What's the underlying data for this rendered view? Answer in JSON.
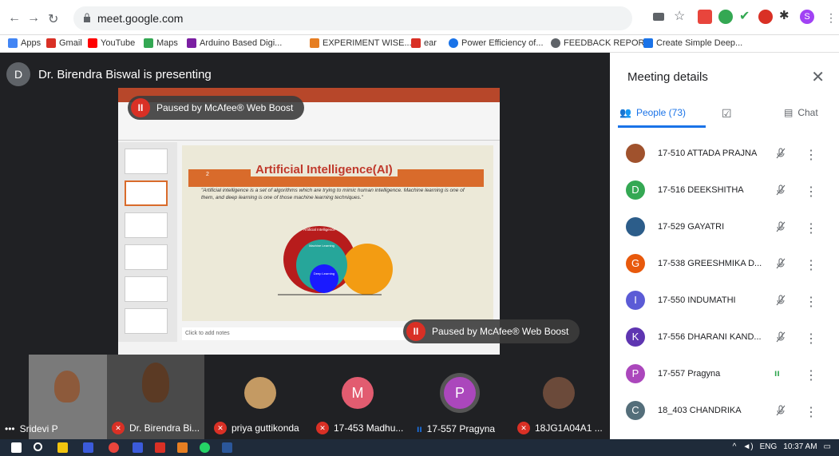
{
  "browser": {
    "url": "meet.google.com"
  },
  "bookmarks": [
    {
      "label": "Apps",
      "color": "#4285f4"
    },
    {
      "label": "Gmail",
      "color": "#d93025"
    },
    {
      "label": "YouTube",
      "color": "#ff0000"
    },
    {
      "label": "Maps",
      "color": "#34a853"
    },
    {
      "label": "Arduino Based Digi...",
      "color": "#7b1fa2"
    },
    {
      "label": "EXPERIMENT WISE...",
      "color": "#e67e22"
    },
    {
      "label": "ear",
      "color": "#d93025"
    },
    {
      "label": "Power Efficiency of...",
      "color": "#1a73e8"
    },
    {
      "label": "FEEDBACK REPORT",
      "color": "#5f6368"
    },
    {
      "label": "Create Simple Deep...",
      "color": "#1a73e8"
    }
  ],
  "presenter": {
    "initial": "D",
    "text": "Dr. Birendra Biswal is presenting"
  },
  "slide": {
    "title": "Artificial Intelligence(AI)",
    "number": "2",
    "text": "\"Artificial intelligence is a set of algorithms which are trying to mimic human intelligence. Machine learning is one of them, and deep learning is one of those machine learning techniques.\"",
    "circles": [
      "Artificial Intelligence",
      "Machine Learning",
      "Deep Learning"
    ],
    "notes": "Click to add notes"
  },
  "pause": {
    "label": "Paused by McAfee® Web Boost"
  },
  "side": {
    "title": "Meeting details",
    "people_tab": "People (73)",
    "chat_tab": "Chat",
    "people": [
      {
        "name": "17-510 ATTADA PRAJNA",
        "initial": "",
        "color": "#a0522d"
      },
      {
        "name": "17-516 DEEKSHITHA",
        "initial": "D",
        "color": "#34a853"
      },
      {
        "name": "17-529 GAYATRI",
        "initial": "",
        "color": "#2c5d8a"
      },
      {
        "name": "17-538 GREESHMIKA D...",
        "initial": "G",
        "color": "#e8590c"
      },
      {
        "name": "17-550 INDUMATHI",
        "initial": "I",
        "color": "#5b5bd6"
      },
      {
        "name": "17-556 DHARANI KAND...",
        "initial": "K",
        "color": "#5e35b1"
      },
      {
        "name": "17-557 Pragyna",
        "initial": "P",
        "color": "#ab47bc"
      },
      {
        "name": "18_403 CHANDRIKA",
        "initial": "C",
        "color": "#546e7a"
      }
    ]
  },
  "tiles": [
    {
      "label": "Sridevi P"
    },
    {
      "label": "Dr. Birendra Bi..."
    },
    {
      "label": "priya guttikonda"
    },
    {
      "label": "17-453 Madhu...",
      "initial": "M",
      "color": "#e25c70"
    },
    {
      "label": "17-557 Pragyna",
      "initial": "P",
      "color": "#ab47bc"
    },
    {
      "label": "18JG1A04A1 ..."
    }
  ],
  "taskbar": {
    "lang": "ENG",
    "time": "10:37 AM"
  }
}
